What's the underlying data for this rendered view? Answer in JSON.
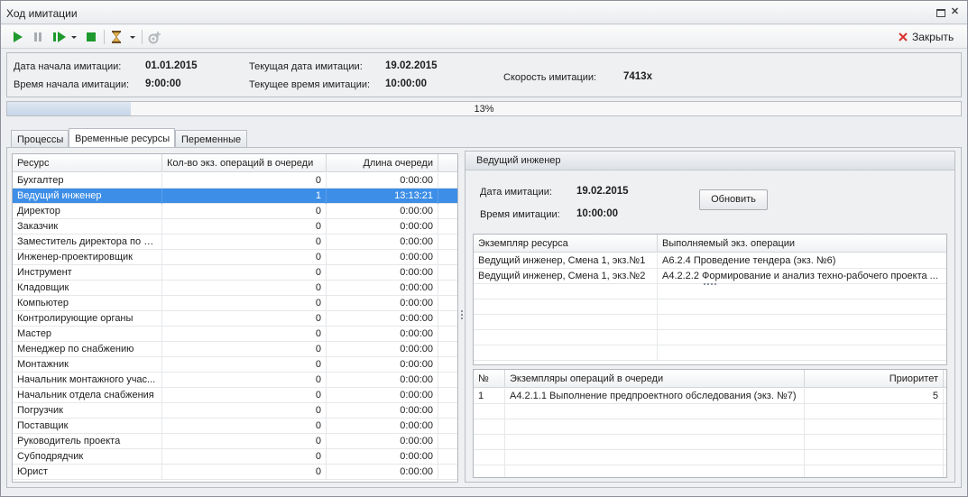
{
  "window": {
    "title": "Ход имитации"
  },
  "toolbar": {
    "icons": [
      "play-icon",
      "pause-icon",
      "step-icon",
      "dropdown-arrow-icon",
      "stop-icon",
      "hourglass-icon",
      "dropdown-arrow-icon",
      "add-gear-icon"
    ],
    "close_label": "Закрыть"
  },
  "info": {
    "start_date_label": "Дата начала имитации:",
    "start_date": "01.01.2015",
    "start_time_label": "Время начала имитации:",
    "start_time": "9:00:00",
    "current_date_label": "Текущая дата имитации:",
    "current_date": "19.02.2015",
    "current_time_label": "Текущее время имитации:",
    "current_time": "10:00:00",
    "speed_label": "Скорость имитации:",
    "speed": "7413x"
  },
  "progress": {
    "text": "13%",
    "value": 0.13
  },
  "tabs": [
    {
      "label": "Процессы",
      "active": false
    },
    {
      "label": "Временные ресурсы",
      "active": true
    },
    {
      "label": "Переменные",
      "active": false
    }
  ],
  "resources": {
    "columns": [
      "Ресурс",
      "Кол-во экз. операций в очереди",
      "Длина очереди"
    ],
    "rows": [
      {
        "name": "Бухгалтер",
        "count": "0",
        "length": "0:00:00"
      },
      {
        "name": "Ведущий инженер",
        "count": "1",
        "length": "13:13:21",
        "selected": true
      },
      {
        "name": "Директор",
        "count": "0",
        "length": "0:00:00"
      },
      {
        "name": "Заказчик",
        "count": "0",
        "length": "0:00:00"
      },
      {
        "name": "Заместитель директора по п...",
        "count": "0",
        "length": "0:00:00"
      },
      {
        "name": "Инженер-проектировщик",
        "count": "0",
        "length": "0:00:00"
      },
      {
        "name": "Инструмент",
        "count": "0",
        "length": "0:00:00"
      },
      {
        "name": "Кладовщик",
        "count": "0",
        "length": "0:00:00"
      },
      {
        "name": "Компьютер",
        "count": "0",
        "length": "0:00:00"
      },
      {
        "name": "Контролирующие органы",
        "count": "0",
        "length": "0:00:00"
      },
      {
        "name": "Мастер",
        "count": "0",
        "length": "0:00:00"
      },
      {
        "name": "Менеджер по снабжению",
        "count": "0",
        "length": "0:00:00"
      },
      {
        "name": "Монтажник",
        "count": "0",
        "length": "0:00:00"
      },
      {
        "name": "Начальник монтажного учас...",
        "count": "0",
        "length": "0:00:00"
      },
      {
        "name": "Начальник отдела снабжения",
        "count": "0",
        "length": "0:00:00"
      },
      {
        "name": "Погрузчик",
        "count": "0",
        "length": "0:00:00"
      },
      {
        "name": "Поставщик",
        "count": "0",
        "length": "0:00:00"
      },
      {
        "name": "Руководитель проекта",
        "count": "0",
        "length": "0:00:00"
      },
      {
        "name": "Субподрядчик",
        "count": "0",
        "length": "0:00:00"
      },
      {
        "name": "Юрист",
        "count": "0",
        "length": "0:00:00"
      }
    ]
  },
  "detail": {
    "title": "Ведущий инженер",
    "date_label": "Дата имитации:",
    "date": "19.02.2015",
    "time_label": "Время имитации:",
    "time": "10:00:00",
    "refresh_label": "Обновить",
    "instances": {
      "columns": [
        "Экземпляр ресурса",
        "Выполняемый экз. операции"
      ],
      "rows": [
        {
          "instance": "Ведущий инженер, Смена 1, экз.№1",
          "operation": "А6.2.4 Проведение тендера (экз. №6)"
        },
        {
          "instance": "Ведущий инженер, Смена 1, экз.№2",
          "operation": "А4.2.2.2 Формирование и анализ техно-рабочего проекта ..."
        }
      ]
    },
    "queue": {
      "columns": [
        "№",
        "Экземпляры операций в очереди",
        "Приоритет"
      ],
      "rows": [
        {
          "num": "1",
          "operation": "А4.2.1.1 Выполнение предпроектного обследования (экз. №7)",
          "priority": "5"
        }
      ]
    }
  },
  "colors": {
    "selection": "#3d8ee6",
    "progress_fill": "#c7d5e7",
    "play_green": "#1f9a2e"
  }
}
